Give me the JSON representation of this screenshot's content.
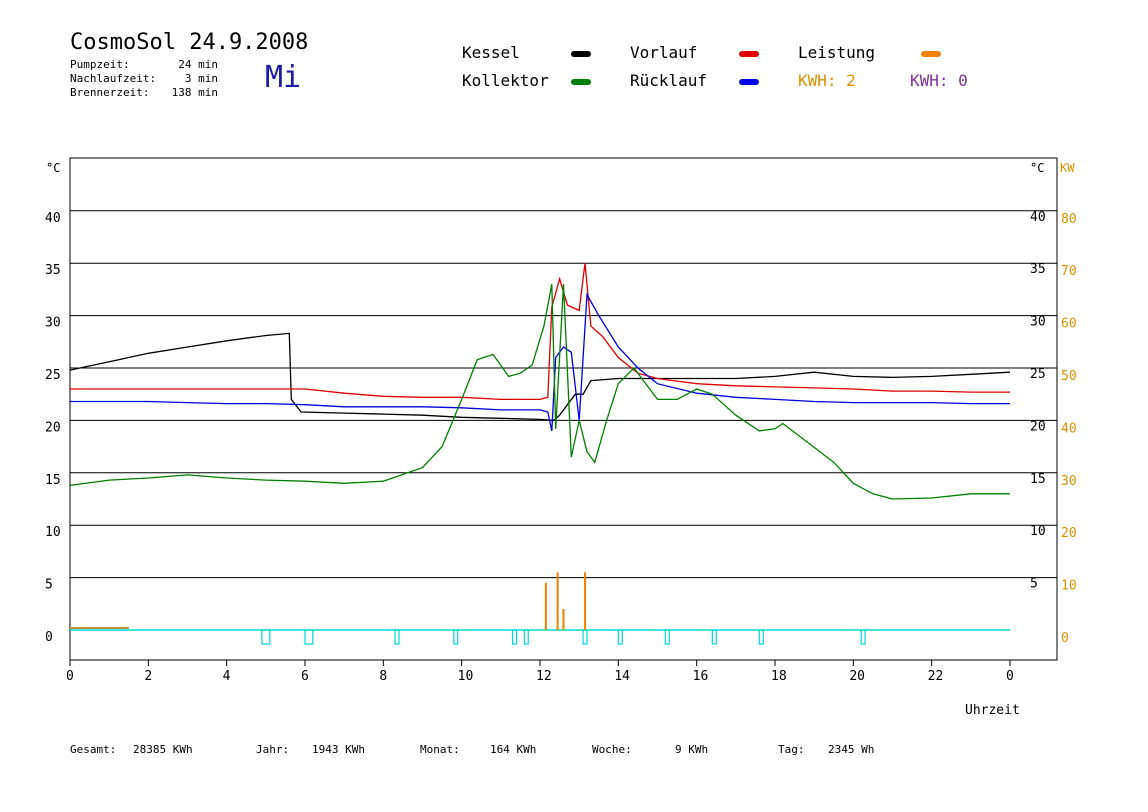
{
  "header": {
    "title": "CosmoSol 24.9.2008",
    "weekday": "Mi",
    "stats": [
      {
        "label": "Pumpzeit:",
        "value": "24 min"
      },
      {
        "label": "Nachlaufzeit:",
        "value": "3 min"
      },
      {
        "label": "Brennerzeit:",
        "value": "138 min"
      }
    ]
  },
  "legend": {
    "items": [
      {
        "label": "Kessel",
        "color": "#000000"
      },
      {
        "label": "Vorlauf",
        "color": "#e00000"
      },
      {
        "label": "Leistung",
        "color": "#f08000"
      },
      {
        "label": "Kollektor",
        "color": "#008000"
      },
      {
        "label": "Rücklauf",
        "color": "#0000e0"
      }
    ],
    "kwh_a": {
      "text": "KWH: 2",
      "color": "#e09000"
    },
    "kwh_b": {
      "text": "KWH: 0",
      "color": "#8030a0"
    }
  },
  "totals": [
    {
      "label": "Gesamt:",
      "value": "28385 KWh"
    },
    {
      "label": "Jahr:",
      "value": "1943 KWh"
    },
    {
      "label": "Monat:",
      "value": "164 KWh"
    },
    {
      "label": "Woche:",
      "value": "9 KWh"
    },
    {
      "label": "Tag:",
      "value": "2345 Wh"
    }
  ],
  "chart_data": {
    "type": "line",
    "xlabel": "Uhrzeit",
    "ylabel_left": "°C",
    "ylabel_right_temp": "°C",
    "ylabel_right_power": "KW",
    "xlim": [
      0,
      24
    ],
    "ylim": [
      0,
      40
    ],
    "ylim_power": [
      0,
      80
    ],
    "x_tick_labels": [
      "0",
      "2",
      "4",
      "6",
      "8",
      "10",
      "12",
      "14",
      "16",
      "18",
      "20",
      "22",
      "0"
    ],
    "y_tick_labels_left": [
      "0",
      "5",
      "10",
      "15",
      "20",
      "25",
      "30",
      "35",
      "40"
    ],
    "y_tick_labels_right": [
      "5",
      "10",
      "15",
      "20",
      "25",
      "30",
      "35",
      "40"
    ],
    "power_tick_labels": [
      "0",
      "10",
      "20",
      "30",
      "40",
      "50",
      "60",
      "70",
      "80"
    ],
    "grid": true,
    "series": [
      {
        "name": "Kessel",
        "color": "#000000",
        "points": [
          [
            0,
            24.8
          ],
          [
            1,
            25.6
          ],
          [
            2,
            26.4
          ],
          [
            3,
            27.0
          ],
          [
            4,
            27.6
          ],
          [
            5,
            28.1
          ],
          [
            5.6,
            28.3
          ],
          [
            5.65,
            22.0
          ],
          [
            5.9,
            20.8
          ],
          [
            7,
            20.7
          ],
          [
            8,
            20.6
          ],
          [
            9,
            20.5
          ],
          [
            10,
            20.3
          ],
          [
            11,
            20.2
          ],
          [
            12,
            20.1
          ],
          [
            12.35,
            20.0
          ],
          [
            12.5,
            20.5
          ],
          [
            12.9,
            22.5
          ],
          [
            13.1,
            22.5
          ],
          [
            13.3,
            23.8
          ],
          [
            14,
            24.0
          ],
          [
            15,
            24.0
          ],
          [
            16,
            24.0
          ],
          [
            17,
            24.0
          ],
          [
            18,
            24.2
          ],
          [
            19,
            24.6
          ],
          [
            20,
            24.2
          ],
          [
            21,
            24.1
          ],
          [
            22,
            24.2
          ],
          [
            23,
            24.4
          ],
          [
            24,
            24.6
          ]
        ]
      },
      {
        "name": "Vorlauf",
        "color": "#e00000",
        "points": [
          [
            0,
            23.0
          ],
          [
            1,
            23.0
          ],
          [
            2,
            23.0
          ],
          [
            3,
            23.0
          ],
          [
            4,
            23.0
          ],
          [
            5,
            23.0
          ],
          [
            6,
            23.0
          ],
          [
            7,
            22.6
          ],
          [
            8,
            22.3
          ],
          [
            9,
            22.2
          ],
          [
            10,
            22.2
          ],
          [
            11,
            22.0
          ],
          [
            12,
            22.0
          ],
          [
            12.2,
            22.2
          ],
          [
            12.3,
            30.8
          ],
          [
            12.5,
            33.5
          ],
          [
            12.7,
            31.0
          ],
          [
            13.0,
            30.5
          ],
          [
            13.15,
            35.0
          ],
          [
            13.3,
            29.0
          ],
          [
            13.6,
            28.0
          ],
          [
            14,
            26.0
          ],
          [
            14.5,
            24.5
          ],
          [
            15,
            24.0
          ],
          [
            16,
            23.5
          ],
          [
            17,
            23.3
          ],
          [
            18,
            23.2
          ],
          [
            19,
            23.1
          ],
          [
            20,
            23.0
          ],
          [
            21,
            22.8
          ],
          [
            22,
            22.8
          ],
          [
            23,
            22.7
          ],
          [
            24,
            22.7
          ]
        ]
      },
      {
        "name": "Rücklauf",
        "color": "#0000e0",
        "points": [
          [
            0,
            21.8
          ],
          [
            1,
            21.8
          ],
          [
            2,
            21.8
          ],
          [
            3,
            21.7
          ],
          [
            4,
            21.6
          ],
          [
            5,
            21.6
          ],
          [
            6,
            21.5
          ],
          [
            7,
            21.3
          ],
          [
            8,
            21.3
          ],
          [
            9,
            21.3
          ],
          [
            10,
            21.2
          ],
          [
            11,
            21.0
          ],
          [
            12,
            21.0
          ],
          [
            12.2,
            20.8
          ],
          [
            12.3,
            19.0
          ],
          [
            12.4,
            26.0
          ],
          [
            12.6,
            27.0
          ],
          [
            12.8,
            26.5
          ],
          [
            13.0,
            20.0
          ],
          [
            13.2,
            32.0
          ],
          [
            13.5,
            30.0
          ],
          [
            14,
            27.0
          ],
          [
            14.5,
            25.0
          ],
          [
            15,
            23.5
          ],
          [
            16,
            22.6
          ],
          [
            17,
            22.2
          ],
          [
            18,
            22.0
          ],
          [
            19,
            21.8
          ],
          [
            20,
            21.7
          ],
          [
            21,
            21.7
          ],
          [
            22,
            21.7
          ],
          [
            23,
            21.6
          ],
          [
            24,
            21.6
          ]
        ]
      },
      {
        "name": "Kollektor",
        "color": "#008000",
        "points": [
          [
            0,
            13.8
          ],
          [
            1,
            14.3
          ],
          [
            2,
            14.5
          ],
          [
            3,
            14.8
          ],
          [
            4,
            14.5
          ],
          [
            5,
            14.3
          ],
          [
            6,
            14.2
          ],
          [
            7,
            14.0
          ],
          [
            8,
            14.2
          ],
          [
            9,
            15.5
          ],
          [
            9.5,
            17.5
          ],
          [
            10,
            22.0
          ],
          [
            10.4,
            25.8
          ],
          [
            10.8,
            26.3
          ],
          [
            11.2,
            24.2
          ],
          [
            11.5,
            24.5
          ],
          [
            11.8,
            25.3
          ],
          [
            12.1,
            29.0
          ],
          [
            12.3,
            33.0
          ],
          [
            12.4,
            19.2
          ],
          [
            12.6,
            33.0
          ],
          [
            12.8,
            16.5
          ],
          [
            13.0,
            20.0
          ],
          [
            13.2,
            17.0
          ],
          [
            13.4,
            16.0
          ],
          [
            13.7,
            20.0
          ],
          [
            14.0,
            23.5
          ],
          [
            14.4,
            25.0
          ],
          [
            15.0,
            22.0
          ],
          [
            15.5,
            22.0
          ],
          [
            16.0,
            23.0
          ],
          [
            16.4,
            22.5
          ],
          [
            17.0,
            20.5
          ],
          [
            17.6,
            19.0
          ],
          [
            18.0,
            19.2
          ],
          [
            18.2,
            19.7
          ],
          [
            18.8,
            18.0
          ],
          [
            19.5,
            16.0
          ],
          [
            20,
            14.0
          ],
          [
            20.5,
            13.0
          ],
          [
            21,
            12.5
          ],
          [
            22,
            12.6
          ],
          [
            23,
            13.0
          ],
          [
            24,
            13.0
          ]
        ]
      }
    ],
    "pump_markers": [
      [
        4.9,
        5.1
      ],
      [
        6.0,
        6.2
      ],
      [
        8.3,
        8.4
      ],
      [
        9.8,
        9.9
      ],
      [
        11.3,
        11.4
      ],
      [
        11.6,
        11.7
      ],
      [
        13.1,
        13.2
      ],
      [
        14.0,
        14.1
      ],
      [
        15.2,
        15.3
      ],
      [
        16.4,
        16.5
      ],
      [
        17.6,
        17.7
      ],
      [
        20.2,
        20.3
      ]
    ],
    "power_spikes": [
      {
        "x": 12.15,
        "kw": 9
      },
      {
        "x": 12.45,
        "kw": 11
      },
      {
        "x": 12.6,
        "kw": 4
      },
      {
        "x": 13.15,
        "kw": 11
      }
    ]
  }
}
